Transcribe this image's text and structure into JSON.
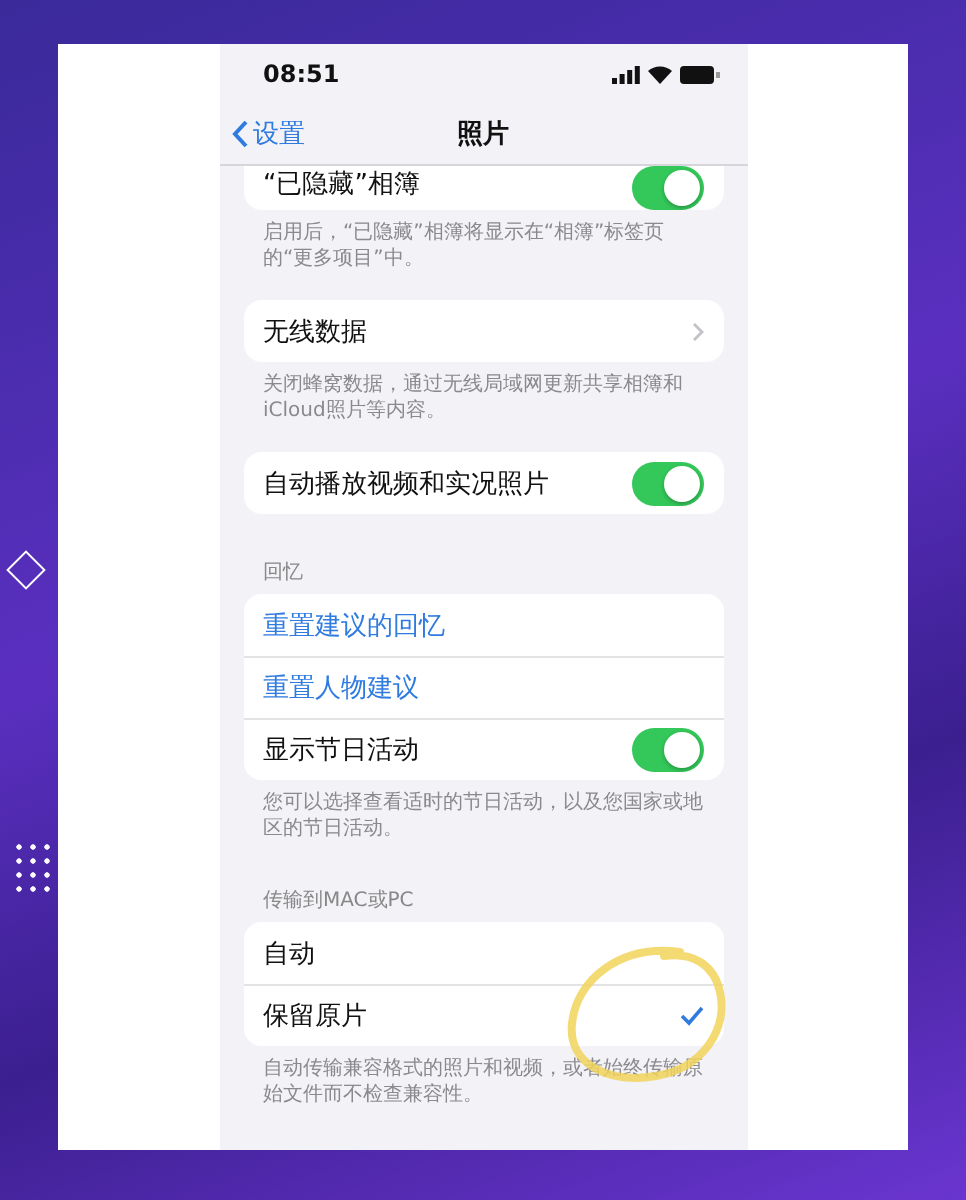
{
  "status_bar": {
    "time": "08:51"
  },
  "nav": {
    "back": "设置",
    "title": "照片"
  },
  "sections": [
    {
      "rows": [
        {
          "kind": "toggle",
          "label": "“已隐藏”相簿",
          "on": true
        }
      ],
      "footer": "启用后，“已隐藏”相簿将显示在“相簿”标签页的“更多项目”中。"
    },
    {
      "rows": [
        {
          "kind": "link",
          "label": "无线数据"
        }
      ],
      "footer": "关闭蜂窝数据，通过无线局域网更新共享相簿和iCloud照片等内容。"
    },
    {
      "rows": [
        {
          "kind": "toggle",
          "label": "自动播放视频和实况照片",
          "on": true
        }
      ]
    },
    {
      "header": "回忆",
      "rows": [
        {
          "kind": "action",
          "label": "重置建议的回忆"
        },
        {
          "kind": "action",
          "label": "重置人物建议"
        },
        {
          "kind": "toggle",
          "label": "显示节日活动",
          "on": true
        }
      ],
      "footer": "您可以选择查看适时的节日活动，以及您国家或地区的节日活动。"
    },
    {
      "header": "传输到MAC或PC",
      "rows": [
        {
          "kind": "check",
          "label": "自动",
          "selected": false
        },
        {
          "kind": "check",
          "label": "保留原片",
          "selected": true
        }
      ],
      "footer": "自动传输兼容格式的照片和视频，或者始终传输原始文件而不检查兼容性。"
    }
  ]
}
